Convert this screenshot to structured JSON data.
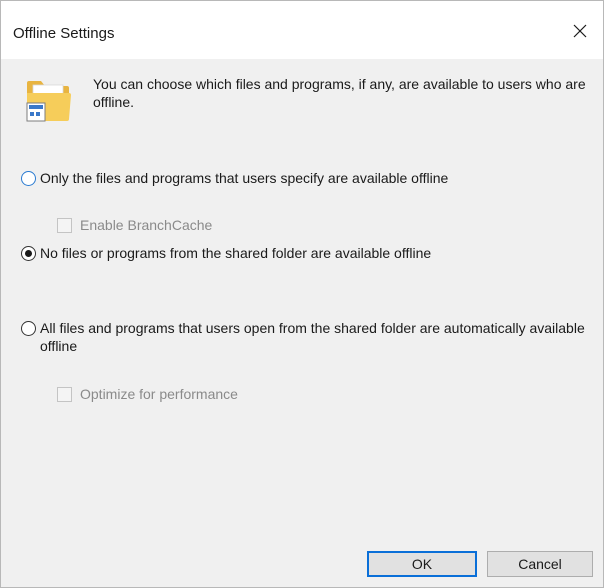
{
  "window": {
    "title": "Offline Settings",
    "close_icon": "close-icon"
  },
  "intro": {
    "icon": "shared-folder-icon",
    "text": "You can choose which files and programs, if any, are available to users who are offline."
  },
  "options": {
    "selected": "none",
    "items": [
      {
        "id": "user-specified",
        "label": "Only the files and programs that users specify are available offline",
        "checked": false
      },
      {
        "id": "none",
        "label": "No files or programs from the shared folder are available offline",
        "checked": true
      },
      {
        "id": "all",
        "label": "All files and programs that users open from the shared folder are automatically available offline",
        "checked": false
      }
    ],
    "branchcache_label": "Enable BranchCache",
    "optimize_label": "Optimize for performance"
  },
  "buttons": {
    "ok_label": "OK",
    "cancel_label": "Cancel"
  },
  "colors": {
    "accent": "#0a6fd8",
    "dialog_bg": "#f0f0f0",
    "titlebar_bg": "#ffffff",
    "disabled_text": "#8a8a8a"
  }
}
